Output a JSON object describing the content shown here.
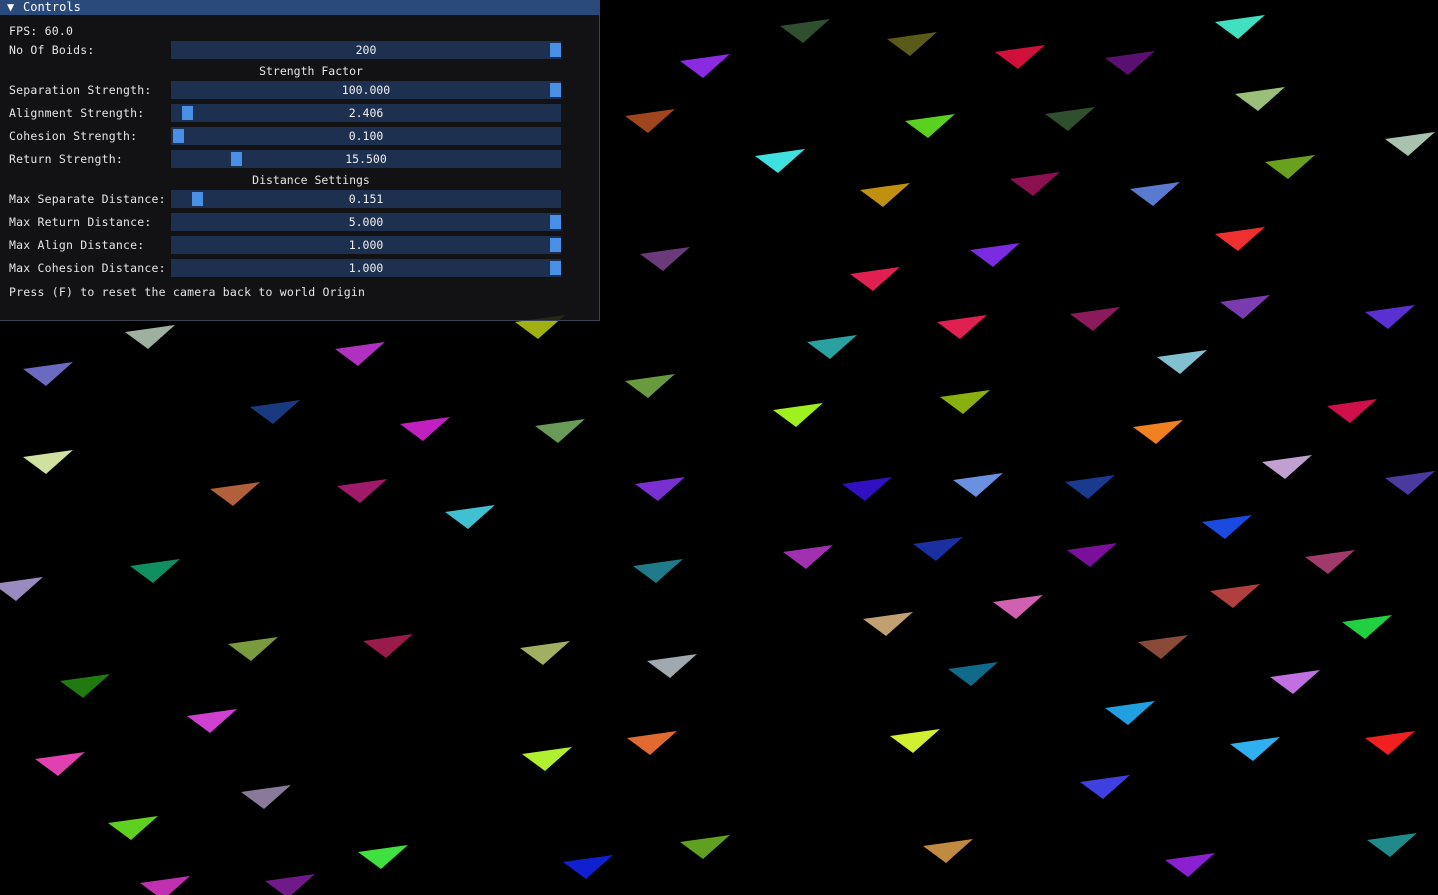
{
  "window": {
    "title": "Controls",
    "collapse_glyph": "▼",
    "fps_label": "FPS: 60.0"
  },
  "controls": {
    "boids": {
      "label": "No Of Boids:",
      "value": "200",
      "fraction": 1.0
    },
    "strength_header": "Strength Factor",
    "separation": {
      "label": "Separation Strength:",
      "value": "100.000",
      "fraction": 1.0
    },
    "alignment": {
      "label": "Alignment Strength:",
      "value": "2.406",
      "fraction": 0.024
    },
    "cohesion": {
      "label": "Cohesion Strength:",
      "value": "0.100",
      "fraction": 0.0
    },
    "return": {
      "label": "Return Strength:",
      "value": "15.500",
      "fraction": 0.155
    },
    "distance_header": "Distance Settings",
    "max_separate": {
      "label": "Max Separate Distance:",
      "value": "0.151",
      "fraction": 0.05
    },
    "max_return": {
      "label": "Max Return Distance:",
      "value": "5.000",
      "fraction": 1.0
    },
    "max_align": {
      "label": "Max Align Distance:",
      "value": "1.000",
      "fraction": 1.0
    },
    "max_cohesion": {
      "label": "Max Cohesion Distance:",
      "value": "1.000",
      "fraction": 1.0
    },
    "hint": "Press (F) to reset the camera back to world Origin"
  },
  "colors": {
    "background": "#000000",
    "title_bar": "#294a7a",
    "slider_bg": "#1e3050",
    "slider_grab": "#4a8fe6"
  }
}
